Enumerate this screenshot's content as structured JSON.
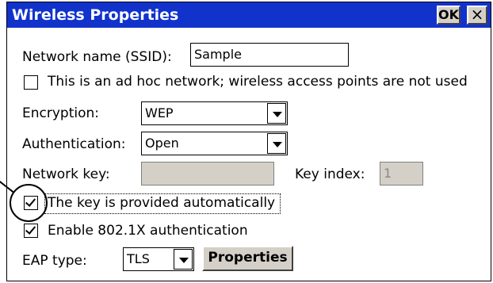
{
  "window": {
    "title": "Wireless Properties",
    "ok_label": "OK",
    "close_label": "×"
  },
  "ssid": {
    "label": "Network name (SSID):",
    "value": "Sample"
  },
  "adhoc": {
    "label": "This is an ad hoc network; wireless access points are not used",
    "checked": false
  },
  "encryption": {
    "label": "Encryption:",
    "value": "WEP"
  },
  "authentication": {
    "label": "Authentication:",
    "value": "Open"
  },
  "network_key": {
    "label": "Network key:",
    "value": ""
  },
  "key_index": {
    "label": "Key index:",
    "value": "1"
  },
  "key_auto": {
    "label": "The key is provided automatically",
    "checked": true
  },
  "enable_8021x": {
    "label": "Enable 802.1X authentication",
    "checked": true
  },
  "eap": {
    "label": "EAP type:",
    "value": "TLS",
    "properties_label": "Properties"
  }
}
